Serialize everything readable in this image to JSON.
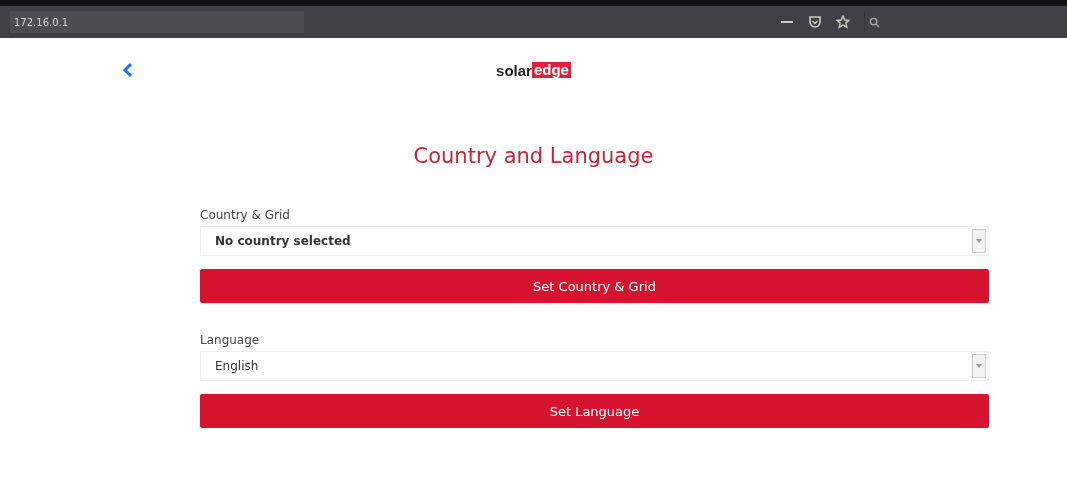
{
  "browser": {
    "address": "172.16.0.1"
  },
  "header": {
    "logo_left": "solar",
    "logo_right": "edge"
  },
  "title": "Country and Language",
  "sections": [
    {
      "label": "Country & Grid",
      "value": "No country selected",
      "value_bold": true,
      "button": "Set Country & Grid"
    },
    {
      "label": "Language",
      "value": "English",
      "value_bold": false,
      "button": "Set Language"
    }
  ]
}
